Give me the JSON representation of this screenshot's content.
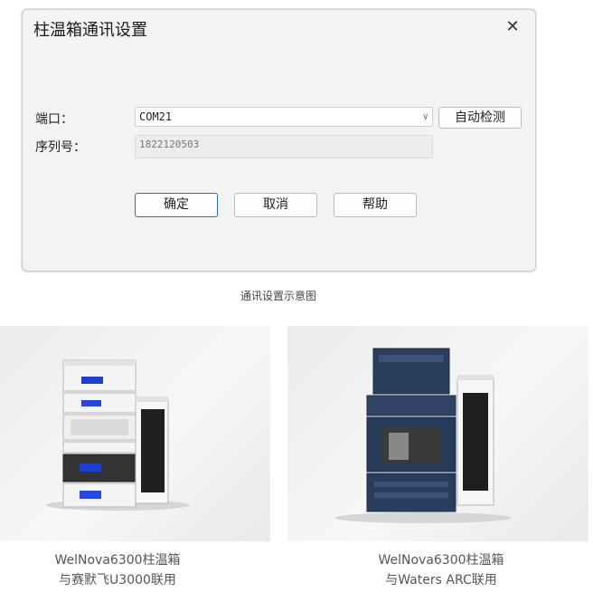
{
  "dialog": {
    "title": "柱温箱通讯设置",
    "close_glyph": "✕",
    "port_label": "端口：",
    "port_value": "COM21",
    "auto_detect_label": "自动检测",
    "serial_label": "序列号：",
    "serial_value": "1822120503",
    "ok_label": "确定",
    "cancel_label": "取消",
    "help_label": "帮助"
  },
  "caption": "通讯设置示意图",
  "products": [
    {
      "line1": "WelNova6300柱温箱",
      "line2": "与赛默飞U3000联用"
    },
    {
      "line1": "WelNova6300柱温箱",
      "line2": "与Waters ARC联用"
    }
  ],
  "colors": {
    "primary_border": "#2b6cc4",
    "dialog_bg": "#f3f3f3"
  }
}
